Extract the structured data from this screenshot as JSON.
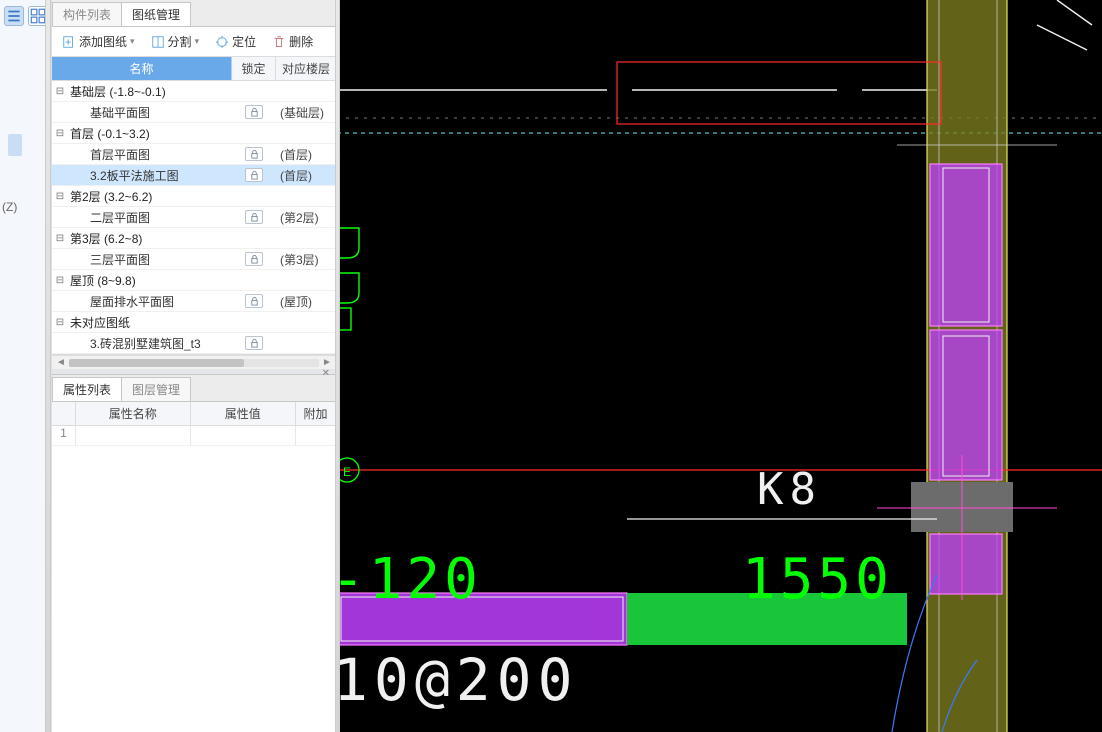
{
  "leftbar": {
    "axis_label": "(Z)"
  },
  "side": {
    "tabs": {
      "components": "构件列表",
      "drawings": "图纸管理"
    },
    "toolbar": {
      "add": "添加图纸",
      "split": "分割",
      "locate": "定位",
      "delete": "删除"
    },
    "tree_head": {
      "name": "名称",
      "lock": "锁定",
      "floor": "对应楼层"
    },
    "tree": [
      {
        "type": "group",
        "label": "基础层 (-1.8~-0.1)"
      },
      {
        "type": "child",
        "label": "基础平面图",
        "lock": true,
        "floor": "(基础层)"
      },
      {
        "type": "group",
        "label": "首层 (-0.1~3.2)"
      },
      {
        "type": "child",
        "label": "首层平面图",
        "lock": true,
        "floor": "(首层)"
      },
      {
        "type": "child",
        "label": "3.2板平法施工图",
        "lock": true,
        "floor": "(首层)",
        "selected": true
      },
      {
        "type": "group",
        "label": "第2层 (3.2~6.2)"
      },
      {
        "type": "child",
        "label": "二层平面图",
        "lock": true,
        "floor": "(第2层)"
      },
      {
        "type": "group",
        "label": "第3层 (6.2~8)"
      },
      {
        "type": "child",
        "label": "三层平面图",
        "lock": true,
        "floor": "(第3层)"
      },
      {
        "type": "group",
        "label": "屋顶 (8~9.8)"
      },
      {
        "type": "child",
        "label": "屋面排水平面图",
        "lock": true,
        "floor": "(屋顶)"
      },
      {
        "type": "group",
        "label": "未对应图纸"
      },
      {
        "type": "child",
        "label": "3.砖混别墅建筑图_t3",
        "lock": true,
        "floor": ""
      }
    ],
    "prop_tabs": {
      "attrs": "属性列表",
      "layers": "图层管理"
    },
    "prop_head": {
      "name": "属性名称",
      "value": "属性值",
      "extra": "附加"
    },
    "prop_rows": [
      {
        "idx": "1",
        "a": "",
        "b": "",
        "c": ""
      }
    ]
  },
  "cad": {
    "grid_label_E": "E",
    "label_K8": "K8",
    "dim_120": "-120",
    "dim_1550": "1550",
    "dim_10at200": "10@200"
  }
}
